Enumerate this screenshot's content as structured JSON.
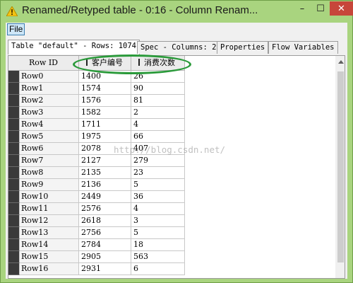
{
  "window": {
    "title": "Renamed/Retyped table - 0:16 - Column Renam...",
    "app_icon": "warning-triangle-icon",
    "controls": {
      "minimize": "–",
      "maximize": "☐",
      "close": "✕"
    }
  },
  "menu": {
    "file": "File"
  },
  "tabs": [
    {
      "label": "Table \"default\" - Rows: 1074"
    },
    {
      "label": "Spec - Columns: 2"
    },
    {
      "label": "Properties"
    },
    {
      "label": "Flow Variables"
    }
  ],
  "table": {
    "headers": {
      "row_id": "Row ID",
      "col1": "客户编号",
      "col2": "消费次数"
    },
    "rows": [
      {
        "id": "Row0",
        "v1": "1400",
        "v2": "26"
      },
      {
        "id": "Row1",
        "v1": "1574",
        "v2": "90"
      },
      {
        "id": "Row2",
        "v1": "1576",
        "v2": "81"
      },
      {
        "id": "Row3",
        "v1": "1582",
        "v2": "2"
      },
      {
        "id": "Row4",
        "v1": "1711",
        "v2": "4"
      },
      {
        "id": "Row5",
        "v1": "1975",
        "v2": "66"
      },
      {
        "id": "Row6",
        "v1": "2078",
        "v2": "407"
      },
      {
        "id": "Row7",
        "v1": "2127",
        "v2": "279"
      },
      {
        "id": "Row8",
        "v1": "2135",
        "v2": "23"
      },
      {
        "id": "Row9",
        "v1": "2136",
        "v2": "5"
      },
      {
        "id": "Row10",
        "v1": "2449",
        "v2": "36"
      },
      {
        "id": "Row11",
        "v1": "2576",
        "v2": "4"
      },
      {
        "id": "Row12",
        "v1": "2618",
        "v2": "3"
      },
      {
        "id": "Row13",
        "v1": "2756",
        "v2": "5"
      },
      {
        "id": "Row14",
        "v1": "2784",
        "v2": "18"
      },
      {
        "id": "Row15",
        "v1": "2905",
        "v2": "563"
      },
      {
        "id": "Row16",
        "v1": "2931",
        "v2": "6"
      }
    ]
  },
  "watermark": "http://blog.csdn.net/",
  "colors": {
    "title_bar": "#a9d47f",
    "close_button": "#c7463a",
    "highlight": "#2a9a3a"
  }
}
